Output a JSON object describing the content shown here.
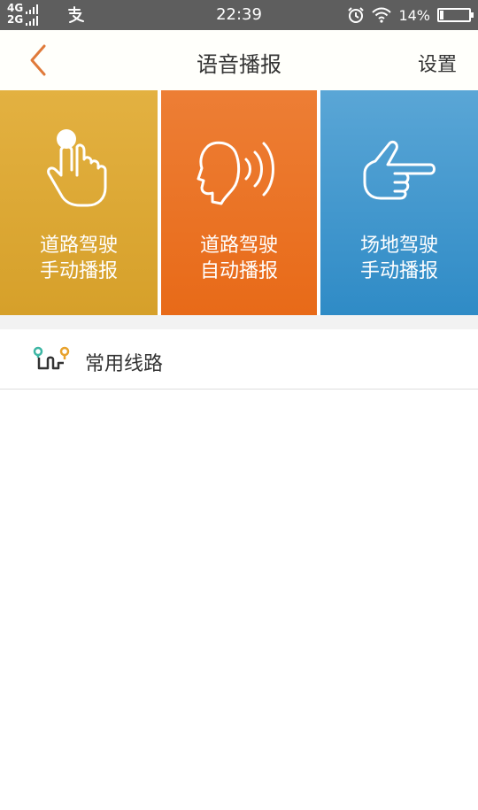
{
  "status_bar": {
    "network_top": "4G",
    "network_bottom": "2G",
    "time": "22:39",
    "battery_percent": "14%",
    "battery_level": 0.14,
    "icons": [
      "signal-icon",
      "alipay-icon",
      "alarm-icon",
      "wifi-icon",
      "battery-icon"
    ]
  },
  "header": {
    "title": "语音播报",
    "settings_label": "设置",
    "back_icon": "chevron-left-icon",
    "accent_color": "#e07a3a"
  },
  "tiles": [
    {
      "line1": "道路驾驶",
      "line2": "手动播报",
      "icon": "tap-hand-icon",
      "color": "#dda735"
    },
    {
      "line1": "道路驾驶",
      "line2": "自动播报",
      "icon": "speaking-head-icon",
      "color": "#ea7324"
    },
    {
      "line1": "场地驾驶",
      "line2": "手动播报",
      "icon": "pointing-hand-icon",
      "color": "#3d97cf"
    }
  ],
  "route_item": {
    "label": "常用线路",
    "icon": "route-pins-icon"
  }
}
